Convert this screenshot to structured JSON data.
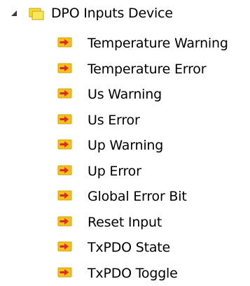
{
  "tree": {
    "root": {
      "label": "DPO Inputs Device",
      "expanded": true,
      "expander_icon": "expanded-triangle-icon",
      "icon": "folder-icon",
      "icon_color": "#f2df3a"
    },
    "children": [
      {
        "label": "Temperature Warning",
        "icon": "input-variable-icon"
      },
      {
        "label": "Temperature Error",
        "icon": "input-variable-icon"
      },
      {
        "label": "Us Warning",
        "icon": "input-variable-icon"
      },
      {
        "label": "Us Error",
        "icon": "input-variable-icon"
      },
      {
        "label": "Up Warning",
        "icon": "input-variable-icon"
      },
      {
        "label": "Up Error",
        "icon": "input-variable-icon"
      },
      {
        "label": "Global Error Bit",
        "icon": "input-variable-icon"
      },
      {
        "label": "Reset Input",
        "icon": "input-variable-icon"
      },
      {
        "label": "TxPDO State",
        "icon": "input-variable-icon"
      },
      {
        "label": "TxPDO Toggle",
        "icon": "input-variable-icon"
      }
    ],
    "colors": {
      "variable_icon_yellow": "#f3c21a",
      "variable_icon_red": "#e22727",
      "folder_yellow": "#f2df3a",
      "folder_edge": "#c8a500"
    }
  }
}
